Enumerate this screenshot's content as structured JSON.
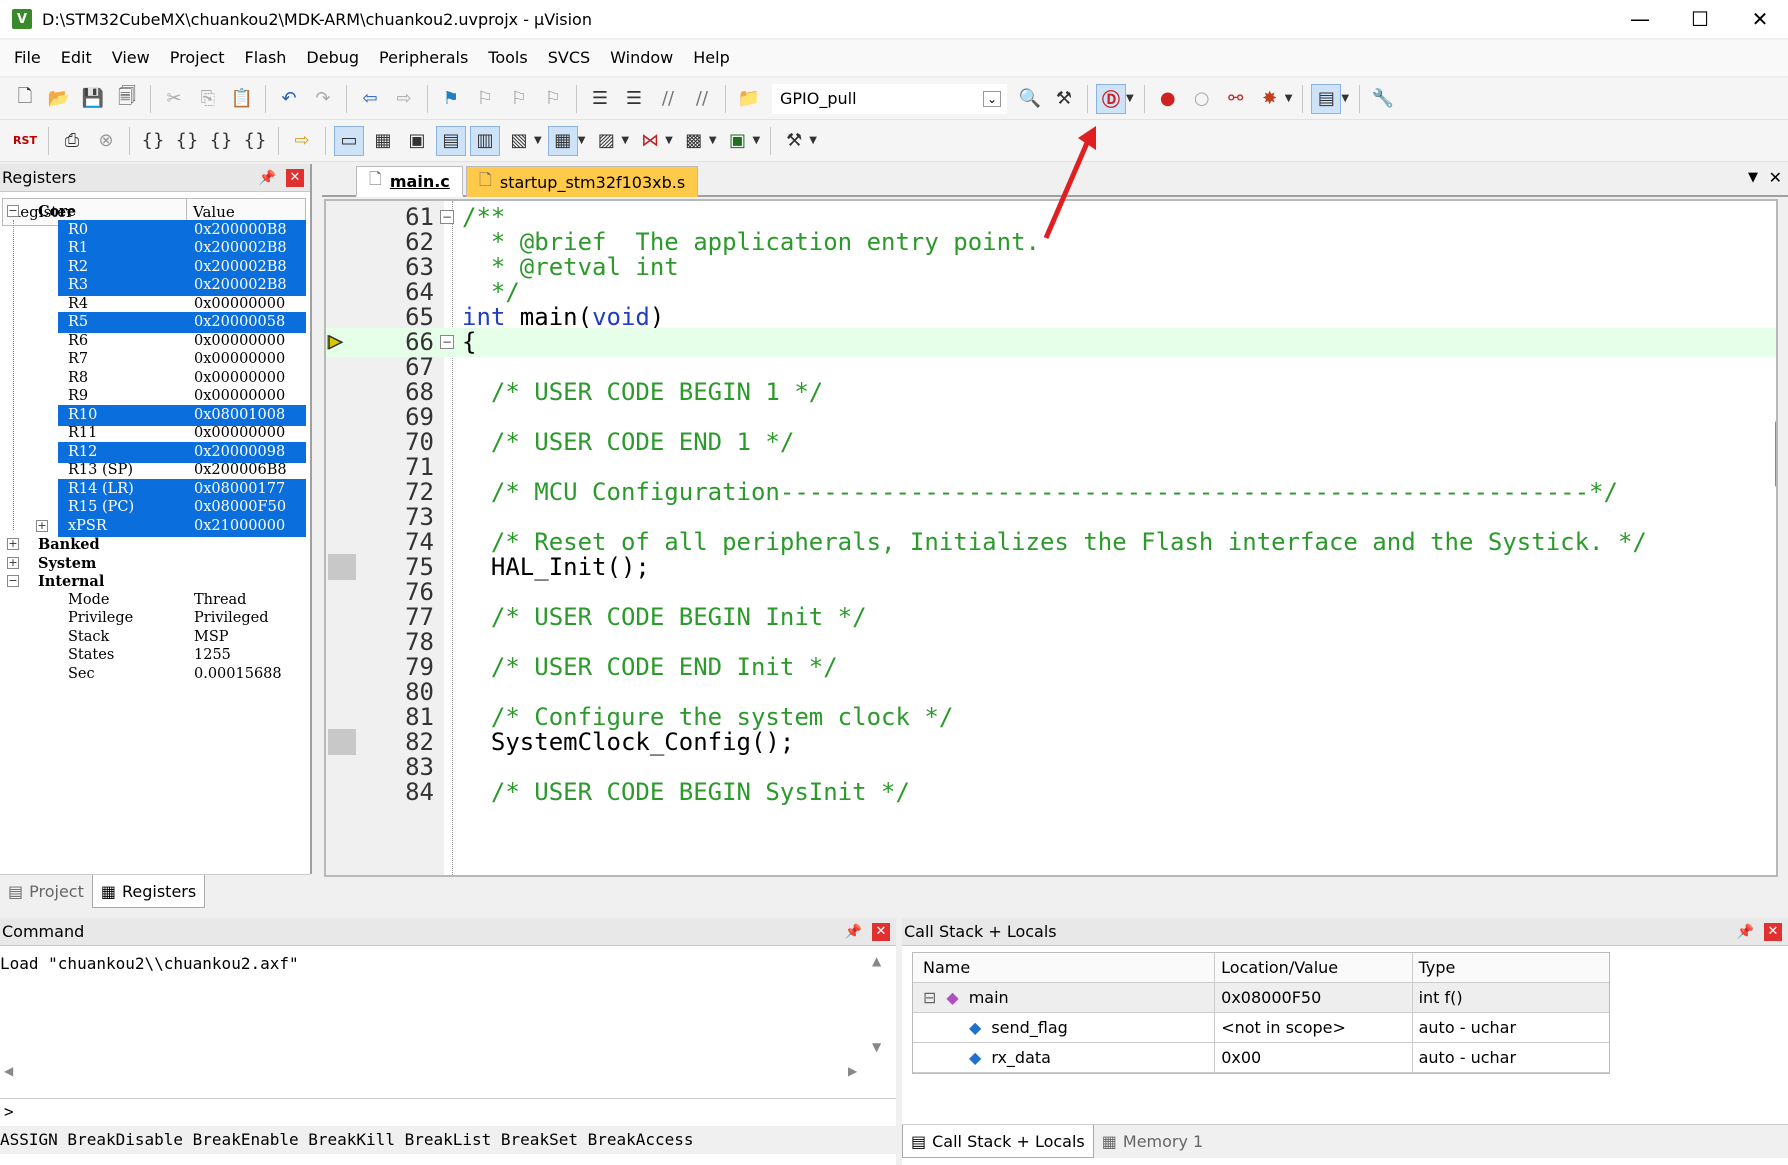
{
  "window": {
    "title": "D:\\STM32CubeMX\\chuankou2\\MDK-ARM\\chuankou2.uvprojx - µVision",
    "minimize": "—",
    "maximize": "☐",
    "close": "✕"
  },
  "menu": [
    "File",
    "Edit",
    "View",
    "Project",
    "Flash",
    "Debug",
    "Peripherals",
    "Tools",
    "SVCS",
    "Window",
    "Help"
  ],
  "toolbar": {
    "target": "GPIO_pull",
    "rst_label": "RST"
  },
  "registers": {
    "title": "Registers",
    "headers": {
      "register": "Register",
      "value": "Value"
    },
    "groups": {
      "core": "Core",
      "banked": "Banked",
      "system": "System",
      "internal": "Internal"
    },
    "core": [
      {
        "name": "R0",
        "value": "0x200000B8",
        "sel": true
      },
      {
        "name": "R1",
        "value": "0x200002B8",
        "sel": true
      },
      {
        "name": "R2",
        "value": "0x200002B8",
        "sel": true
      },
      {
        "name": "R3",
        "value": "0x200002B8",
        "sel": true
      },
      {
        "name": "R4",
        "value": "0x00000000",
        "sel": false
      },
      {
        "name": "R5",
        "value": "0x20000058",
        "sel": true
      },
      {
        "name": "R6",
        "value": "0x00000000",
        "sel": false
      },
      {
        "name": "R7",
        "value": "0x00000000",
        "sel": false
      },
      {
        "name": "R8",
        "value": "0x00000000",
        "sel": false
      },
      {
        "name": "R9",
        "value": "0x00000000",
        "sel": false
      },
      {
        "name": "R10",
        "value": "0x08001008",
        "sel": true
      },
      {
        "name": "R11",
        "value": "0x00000000",
        "sel": false
      },
      {
        "name": "R12",
        "value": "0x20000098",
        "sel": true
      },
      {
        "name": "R13 (SP)",
        "value": "0x200006B8",
        "sel": false
      },
      {
        "name": "R14 (LR)",
        "value": "0x08000177",
        "sel": true
      },
      {
        "name": "R15 (PC)",
        "value": "0x08000F50",
        "sel": true
      },
      {
        "name": "xPSR",
        "value": "0x21000000",
        "sel": true
      }
    ],
    "internal": [
      {
        "name": "Mode",
        "value": "Thread"
      },
      {
        "name": "Privilege",
        "value": "Privileged"
      },
      {
        "name": "Stack",
        "value": "MSP"
      },
      {
        "name": "States",
        "value": "1255"
      },
      {
        "name": "Sec",
        "value": "0.00015688"
      }
    ],
    "tabs": {
      "project": "Project",
      "registers": "Registers"
    }
  },
  "editor": {
    "tabs": {
      "main": "main.c",
      "startup": "startup_stm32f103xb.s"
    },
    "lines": [
      {
        "n": "61",
        "t": "/**",
        "c": "cm",
        "fold": "⊟"
      },
      {
        "n": "62",
        "t": "  * @brief  The application entry point.",
        "c": "cm"
      },
      {
        "n": "63",
        "t": "  * @retval int",
        "c": "cm"
      },
      {
        "n": "64",
        "t": "  */",
        "c": "cm"
      },
      {
        "n": "65",
        "t": "int main(void)",
        "c": "code"
      },
      {
        "n": "66",
        "t": "{",
        "c": "plain",
        "fold": "⊟",
        "current": true
      },
      {
        "n": "67",
        "t": "",
        "c": "plain"
      },
      {
        "n": "68",
        "t": "  /* USER CODE BEGIN 1 */",
        "c": "cm"
      },
      {
        "n": "69",
        "t": "",
        "c": "plain"
      },
      {
        "n": "70",
        "t": "  /* USER CODE END 1 */",
        "c": "cm"
      },
      {
        "n": "71",
        "t": "",
        "c": "plain"
      },
      {
        "n": "72",
        "t": "  /* MCU Configuration--------------------------------------------------------*/",
        "c": "cm"
      },
      {
        "n": "73",
        "t": "",
        "c": "plain"
      },
      {
        "n": "74",
        "t": "  /* Reset of all peripherals, Initializes the Flash interface and the Systick. */",
        "c": "cm"
      },
      {
        "n": "75",
        "t": "  HAL_Init();",
        "c": "plain",
        "bp": true
      },
      {
        "n": "76",
        "t": "",
        "c": "plain"
      },
      {
        "n": "77",
        "t": "  /* USER CODE BEGIN Init */",
        "c": "cm"
      },
      {
        "n": "78",
        "t": "",
        "c": "plain"
      },
      {
        "n": "79",
        "t": "  /* USER CODE END Init */",
        "c": "cm"
      },
      {
        "n": "80",
        "t": "",
        "c": "plain"
      },
      {
        "n": "81",
        "t": "  /* Configure the system clock */",
        "c": "cm"
      },
      {
        "n": "82",
        "t": "  SystemClock_Config();",
        "c": "plain",
        "bp": true
      },
      {
        "n": "83",
        "t": "",
        "c": "plain"
      },
      {
        "n": "84",
        "t": "  /* USER CODE BEGIN SysInit */",
        "c": "cm"
      }
    ]
  },
  "command": {
    "title": "Command",
    "output": "Load \"chuankou2\\\\chuankou2.axf\"",
    "prompt": ">",
    "hints": "ASSIGN BreakDisable BreakEnable BreakKill BreakList BreakSet BreakAccess"
  },
  "callstack": {
    "title": "Call Stack + Locals",
    "headers": {
      "name": "Name",
      "location": "Location/Value",
      "type": "Type"
    },
    "rows": [
      {
        "name": "main",
        "value": "0x08000F50",
        "type": "int f()"
      },
      {
        "name": "send_flag",
        "value": "<not in scope>",
        "type": "auto - uchar"
      },
      {
        "name": "rx_data",
        "value": "0x00",
        "type": "auto - uchar"
      }
    ],
    "tabs": {
      "callstack": "Call Stack + Locals",
      "memory": "Memory 1"
    }
  },
  "colors": {
    "selection": "#0a6fdc",
    "current_line": "#e6ffe9",
    "comment": "#2b9a2b",
    "keyword": "#1f3fbf",
    "annotation_arrow": "#e02020"
  }
}
